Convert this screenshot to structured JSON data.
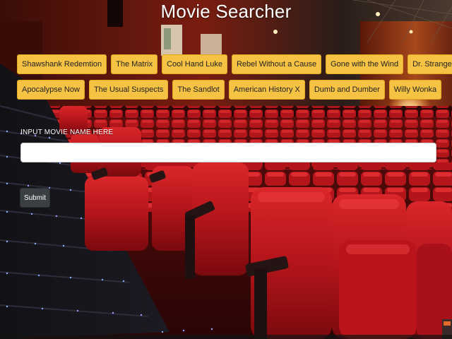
{
  "page": {
    "title": "Movie Searcher"
  },
  "movies": {
    "row1": [
      "Shawshank Redemtion",
      "The Matrix",
      "Cool Hand Luke",
      "Rebel Without a Cause",
      "Gone with the Wind",
      "Dr. Strangelove"
    ],
    "row2": [
      "Apocalypse Now",
      "The Usual Suspects",
      "The Sandlot",
      "American History X",
      "Dumb and Dumber",
      "Willy Wonka"
    ]
  },
  "search": {
    "label": "INPUT MOVIE NAME HERE",
    "value": "",
    "placeholder": "",
    "submit_label": "Submit"
  },
  "colors": {
    "movie_button_bg": "#f6c244",
    "submit_button_bg": "#3a3f44",
    "seat_red": "#b8141a"
  }
}
